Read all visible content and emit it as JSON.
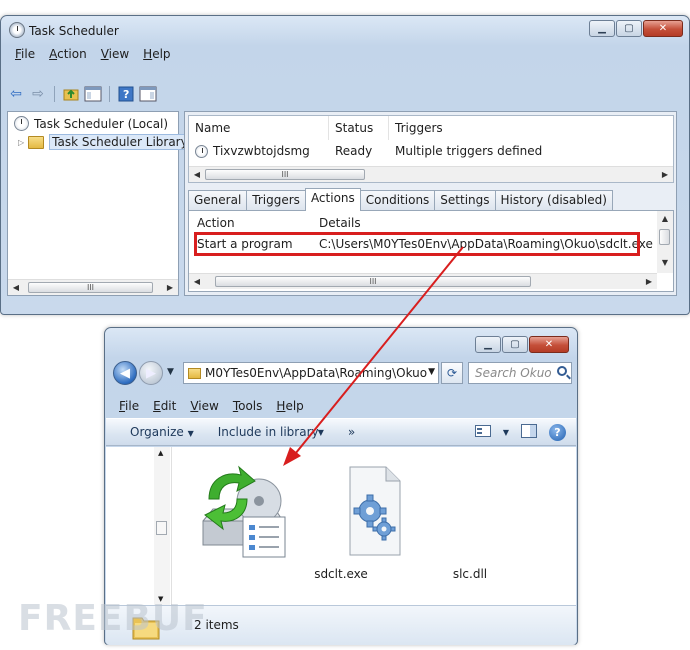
{
  "task_scheduler": {
    "title": "Task Scheduler",
    "menu": [
      "File",
      "Action",
      "View",
      "Help"
    ],
    "tree": {
      "root": "Task Scheduler (Local)",
      "library": "Task Scheduler Library"
    },
    "columns": {
      "name": "Name",
      "status": "Status",
      "triggers": "Triggers"
    },
    "task": {
      "name": "Tixvzwbtojdsmg",
      "status": "Ready",
      "triggers": "Multiple triggers defined"
    },
    "tabs": [
      "General",
      "Triggers",
      "Actions",
      "Conditions",
      "Settings",
      "History (disabled)"
    ],
    "active_tab": "Actions",
    "action_columns": {
      "action": "Action",
      "details": "Details"
    },
    "action_row": {
      "action": "Start a program",
      "details": "C:\\Users\\M0YTes0Env\\AppData\\Roaming\\Okuo\\sdclt.exe"
    },
    "scroll_glyph": "III"
  },
  "explorer": {
    "address": "M0YTes0Env\\AppData\\Roaming\\Okuo",
    "search_placeholder": "Search Okuo",
    "menu": [
      "File",
      "Edit",
      "View",
      "Tools",
      "Help"
    ],
    "commands": {
      "organize": "Organize",
      "include": "Include in library",
      "more": "»"
    },
    "files": [
      {
        "name": "sdclt.exe",
        "icon": "sdclt-exe-icon"
      },
      {
        "name": "slc.dll",
        "icon": "dll-file-icon"
      }
    ],
    "item_count": "2 items"
  },
  "colors": {
    "highlight": "#d81e1e",
    "arrow": "#d81e1e",
    "chrome": "#c9d9ec"
  },
  "watermark": "FREEBUF"
}
